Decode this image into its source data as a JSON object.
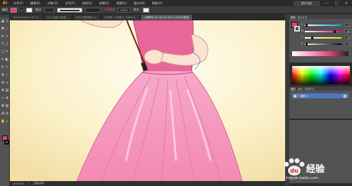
{
  "app": {
    "logo": "Ai"
  },
  "menu": [
    "文件(F)",
    "编辑(E)",
    "对象(O)",
    "文字(T)",
    "选择(S)",
    "效果(C)",
    "视图(V)",
    "窗口(W)",
    "帮助(H)"
  ],
  "workspace": "基本功能",
  "window_buttons": [
    "—",
    "□",
    "✕"
  ],
  "controlbar": {
    "mode_label": "编组",
    "stroke_label": "描边:",
    "style_label": "不透明度",
    "opacity_value": "100%",
    "style_text": "样式:"
  },
  "tabs": [
    "1D9114H9.ai* @ 33...",
    "%1# 绘制 [转换]...",
    "1664 钢琴类型.ai...",
    "未标题-2 [转换] 2 286924...",
    "小提琴手.ai* @ 255.85% (CMYK/预览)"
  ],
  "active_tab_index": 4,
  "status": {
    "zoom": "255.85%",
    "page": "1",
    "mode": "直接选择"
  },
  "colors": {
    "fill": "#e0447c",
    "accent_swatch": "#e0447c",
    "dress": "#f08cb4",
    "bodice": "#e8669a",
    "skin": "#fde2d2",
    "background_gradient_center": "#fffbe8"
  },
  "color_panel": {
    "tabs": [
      "颜色",
      "颜色参考"
    ],
    "channels": [
      {
        "label": "C",
        "value": "0",
        "knob": 0.02,
        "track": [
          "#ffffff",
          "#00a0e0"
        ]
      },
      {
        "label": "M",
        "value": "82",
        "knob": 0.82,
        "track": [
          "#ffffff",
          "#e0007a"
        ]
      },
      {
        "label": "Y",
        "value": "18",
        "knob": 0.18,
        "track": [
          "#ffffff",
          "#f0e000"
        ]
      },
      {
        "label": "K",
        "value": "0",
        "knob": 0.02,
        "track": [
          "#ffffff",
          "#000000"
        ]
      }
    ]
  },
  "layers_panel": {
    "tabs": [
      "图层",
      "画板",
      "资源导出"
    ],
    "layer_name": "图层 1"
  },
  "tools": [
    "selection-icon",
    "direct-selection-icon",
    "magic-wand-icon",
    "lasso-icon",
    "pen-icon",
    "curvature-icon",
    "type-icon",
    "line-icon",
    "rectangle-icon",
    "paintbrush-icon",
    "pencil-icon",
    "eraser-icon",
    "rotate-icon",
    "scale-icon",
    "width-icon",
    "free-transform-icon",
    "shape-builder-icon",
    "perspective-icon",
    "mesh-icon",
    "gradient-icon",
    "eyedropper-icon",
    "blend-icon",
    "symbol-sprayer-icon",
    "graph-icon",
    "artboard-icon",
    "slice-icon",
    "hand-icon",
    "zoom-icon"
  ],
  "watermark": {
    "text": "经验",
    "sub": "jingyan.baidu.com"
  }
}
